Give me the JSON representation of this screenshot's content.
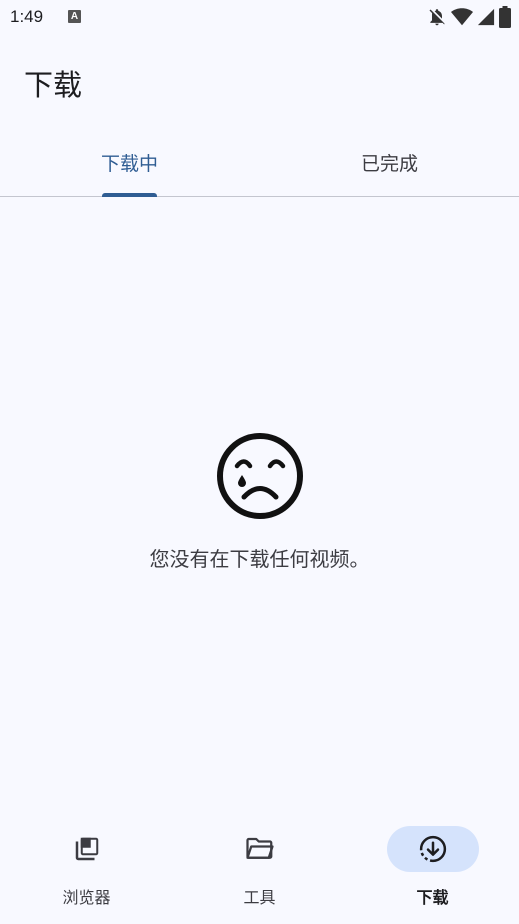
{
  "status_bar": {
    "time": "1:49",
    "notification_badge": "A"
  },
  "header": {
    "title": "下载"
  },
  "tabs": [
    {
      "label": "下载中",
      "active": true
    },
    {
      "label": "已完成",
      "active": false
    }
  ],
  "empty_state": {
    "icon": "sad-face-icon",
    "message": "您没有在下载任何视频。"
  },
  "bottom_nav": {
    "items": [
      {
        "label": "浏览器",
        "icon": "tabs-icon",
        "active": false
      },
      {
        "label": "工具",
        "icon": "folder-icon",
        "active": false
      },
      {
        "label": "下载",
        "icon": "download-icon",
        "active": true
      }
    ]
  },
  "colors": {
    "background": "#f8f9ff",
    "accent": "#2f5d93",
    "active_nav_pill": "#d5e3fc",
    "text_primary": "#1d1d20",
    "text_secondary": "#3c3c42",
    "divider": "#c4c6cf"
  }
}
